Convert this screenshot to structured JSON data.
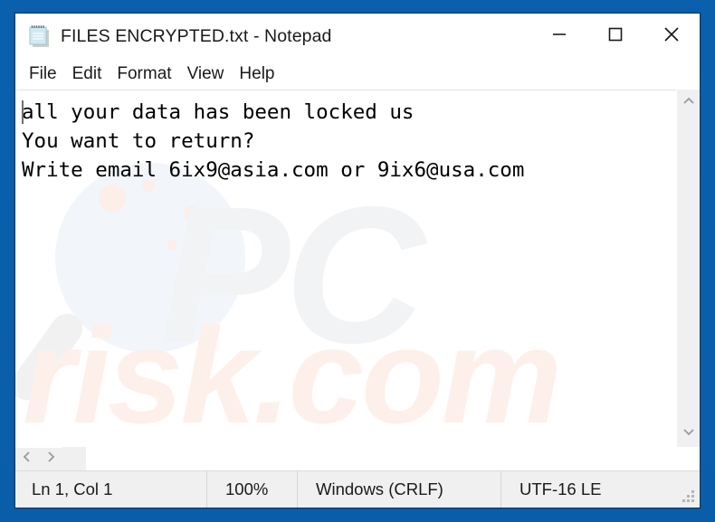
{
  "window": {
    "title": "FILES ENCRYPTED.txt - Notepad",
    "icon": "notepad-icon",
    "controls": {
      "minimize": "minimize-icon",
      "maximize": "maximize-icon",
      "close": "close-icon"
    }
  },
  "menu": {
    "items": [
      {
        "label": "File"
      },
      {
        "label": "Edit"
      },
      {
        "label": "Format"
      },
      {
        "label": "View"
      },
      {
        "label": "Help"
      }
    ]
  },
  "document": {
    "lines": [
      "all your data has been locked us",
      "You want to return?",
      "Write email 6ix9@asia.com or 9ix6@usa.com"
    ],
    "text": "all your data has been locked us\nYou want to return?\nWrite email 6ix9@asia.com or 9ix6@usa.com",
    "emails": [
      "6ix9@asia.com",
      "9ix6@usa.com"
    ]
  },
  "watermark": {
    "primary": "PC",
    "secondary": "risk.com",
    "primary_color": "#f2f3f4",
    "secondary_color": "#fdf0ea"
  },
  "scrollbars": {
    "vertical": {
      "up": "chevron-up-icon",
      "down": "chevron-down-icon"
    },
    "horizontal": {
      "left": "chevron-left-icon",
      "right": "chevron-right-icon"
    }
  },
  "status_bar": {
    "position": "Ln 1, Col 1",
    "zoom": "100%",
    "line_ending": "Windows (CRLF)",
    "encoding": "UTF-16 LE"
  },
  "colors": {
    "desktop_background": "#0a60ad",
    "window_border": "#15395c",
    "window_background": "#ffffff",
    "status_background": "#f0f0f0",
    "text_color": "#000000"
  }
}
